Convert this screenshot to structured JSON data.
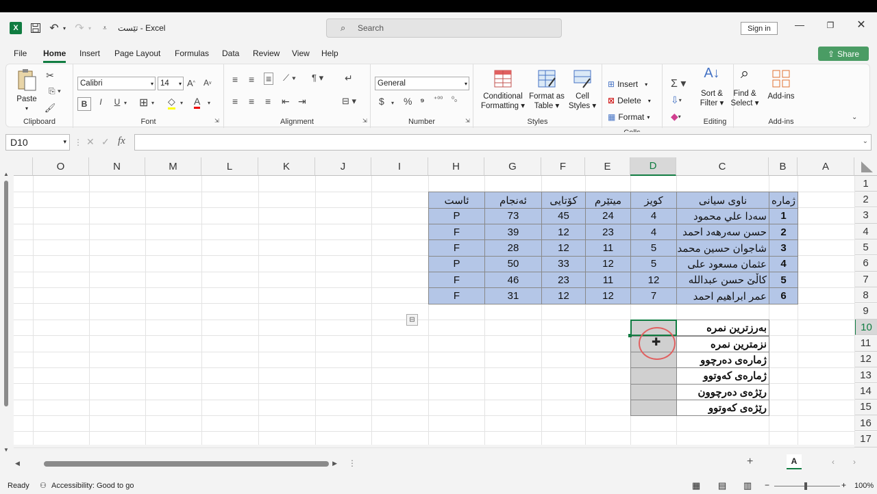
{
  "window": {
    "title": "تێست  -  Excel",
    "search_placeholder": "Search",
    "signin": "Sign in"
  },
  "menu": {
    "tabs": [
      "File",
      "Home",
      "Insert",
      "Page Layout",
      "Formulas",
      "Data",
      "Review",
      "View",
      "Help"
    ],
    "share": "Share"
  },
  "ribbon": {
    "clipboard": {
      "paste": "Paste",
      "label": "Clipboard"
    },
    "font": {
      "name": "Calibri",
      "size": "14",
      "label": "Font",
      "bold": "B",
      "italic": "I",
      "underline": "U"
    },
    "alignment": {
      "label": "Alignment"
    },
    "number": {
      "format": "General",
      "label": "Number",
      "currency": "$",
      "percent": "%",
      "comma": "⁹"
    },
    "styles": {
      "conditional1": "Conditional",
      "conditional2": "Formatting",
      "formatas1": "Format as",
      "formatas2": "Table",
      "cellstyles1": "Cell",
      "cellstyles2": "Styles",
      "label": "Styles"
    },
    "cells": {
      "insert": "Insert",
      "delete": "Delete",
      "format": "Format",
      "label": "Cells"
    },
    "editing": {
      "sort1": "Sort &",
      "sort2": "Filter",
      "find1": "Find &",
      "find2": "Select",
      "label": "Editing"
    },
    "addins": {
      "btn": "Add-ins",
      "label": "Add-ins"
    }
  },
  "formula_bar": {
    "cell_ref": "D10",
    "fx": "fx",
    "content": ""
  },
  "sheet": {
    "columns": [
      "O",
      "N",
      "M",
      "L",
      "K",
      "J",
      "I",
      "H",
      "G",
      "F",
      "E",
      "D",
      "C",
      "B",
      "A"
    ],
    "rows": [
      "1",
      "2",
      "3",
      "4",
      "5",
      "6",
      "7",
      "8",
      "9",
      "10",
      "11",
      "12",
      "13",
      "14",
      "15",
      "16",
      "17"
    ],
    "selected_cell": "D10",
    "table_headers": {
      "B": "ژماره",
      "C": "ناوی سیانی",
      "D": "کویز",
      "E": "میتێرم",
      "F": "کۆتایی",
      "G": "ئەنجام",
      "H": "ئاست"
    },
    "table_rows": [
      {
        "B": "1",
        "C": "سەدا علي محمود",
        "D": "4",
        "E": "24",
        "F": "45",
        "G": "73",
        "H": "P"
      },
      {
        "B": "2",
        "C": "حسن سەرهەد احمد",
        "D": "4",
        "E": "23",
        "F": "12",
        "G": "39",
        "H": "F"
      },
      {
        "B": "3",
        "C": "شاجوان حسين محمد",
        "D": "5",
        "E": "11",
        "F": "12",
        "G": "28",
        "H": "F"
      },
      {
        "B": "4",
        "C": "عثمان مسعود علی",
        "D": "5",
        "E": "12",
        "F": "33",
        "G": "50",
        "H": "P"
      },
      {
        "B": "5",
        "C": "کاڵێ حسن عبدالله",
        "D": "12",
        "E": "11",
        "F": "23",
        "G": "46",
        "H": "F"
      },
      {
        "B": "6",
        "C": "عمر ابراهيم احمد",
        "D": "7",
        "E": "12",
        "F": "12",
        "G": "31",
        "H": "F"
      }
    ],
    "stats_labels": [
      "بەرزترین نمرە",
      "نزمترین نمرە",
      "ژمارەی دەرچوو",
      "ژمارەی کەوتوو",
      "رێژەی  دەرچوون",
      "رێژەی کەوتوو"
    ]
  },
  "status": {
    "ready": "Ready",
    "accessibility": "Accessibility: Good to go",
    "zoom": "100%",
    "new_sheet": "+"
  },
  "colors": {
    "accent": "#107c41",
    "table_fill": "#b4c6e7",
    "stats_fill": "#d0d0d0"
  }
}
